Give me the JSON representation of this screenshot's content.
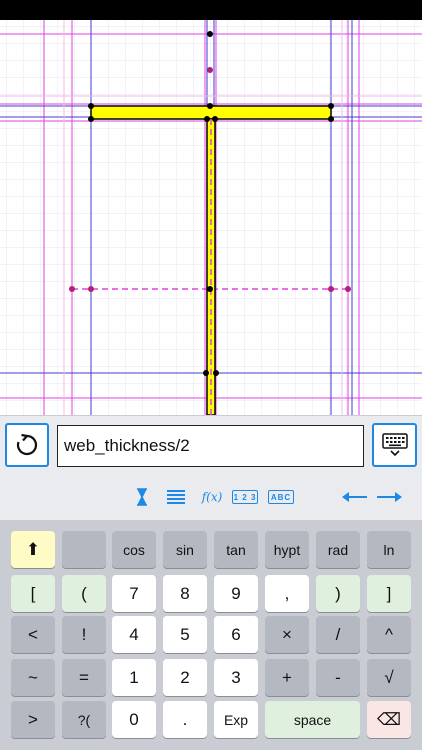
{
  "input": {
    "value": "web_thickness/2"
  },
  "toolbar": {
    "undo_icon": "undo-icon",
    "keyboard_icon": "keyboard-hide-icon"
  },
  "mode_bar": {
    "items": [
      "hourglass-icon",
      "list-icon",
      "f(x)",
      "123",
      "ABC"
    ],
    "fx_label": "f(x)",
    "numeric_label": "1 2 3",
    "alpha_label": "ABC",
    "arrows": [
      "left-arrow-icon",
      "right-arrow-icon"
    ]
  },
  "keyboard": {
    "row1": [
      "⬆",
      "",
      "cos",
      "sin",
      "tan",
      "hypt",
      "rad",
      "ln"
    ],
    "row2": [
      "[",
      "(",
      "7",
      "8",
      "9",
      ",",
      ")",
      "]"
    ],
    "row3": [
      "<",
      "!",
      "4",
      "5",
      "6",
      "×",
      "/",
      "^"
    ],
    "row4": [
      "~",
      "=",
      "1",
      "2",
      "3",
      "+",
      "-",
      "√"
    ],
    "row5": [
      ">",
      "?(",
      "0",
      ".",
      "Exp",
      "space",
      "⌫"
    ]
  },
  "colors": {
    "accent": "#1e88e5",
    "beam_fill": "#ffff00",
    "magenta_line": "#e040e0",
    "blue_line": "#3c3cd0"
  }
}
